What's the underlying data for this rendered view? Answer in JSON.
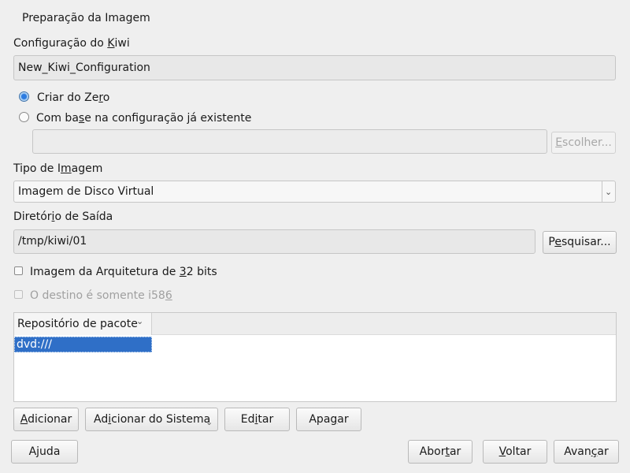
{
  "page": {
    "heading": "Preparação da Imagem"
  },
  "kiwi": {
    "label_pre": "Configuração do ",
    "label_ul": "K",
    "label_post": "iwi",
    "value": "New_Kiwi_Configuration"
  },
  "source": {
    "scratch_pre": "Criar do Ze",
    "scratch_ul": "r",
    "scratch_post": "o",
    "existing_pre": "Com ba",
    "existing_ul": "s",
    "existing_post": "e na configuração já existente",
    "existing_path": "",
    "choose_pre": "",
    "choose_ul": "E",
    "choose_post": "scolher..."
  },
  "image_type": {
    "label_pre": "Tipo de I",
    "label_ul": "m",
    "label_post": "agem",
    "selected": "Imagem de Disco Virtual"
  },
  "output": {
    "label_pre": "Diretór",
    "label_ul": "i",
    "label_post": "o de Saída",
    "value": "/tmp/kiwi/01",
    "browse_pre": "P",
    "browse_ul": "e",
    "browse_post": "squisar..."
  },
  "arch32": {
    "pre": "Imagem da Arquitetura de ",
    "ul": "3",
    "post": "2 bits"
  },
  "i586": {
    "pre": "O destino é somente i58",
    "ul": "6",
    "post": ""
  },
  "repos": {
    "column": "Repositório de pacote",
    "rows": [
      "dvd:///"
    ]
  },
  "repo_buttons": {
    "add_pre": "",
    "add_ul": "A",
    "add_post": "dicionar",
    "addsys_pre": "Ad",
    "addsys_ul": "i",
    "addsys_post": "cionar do Sistema",
    "edit_pre": "Ed",
    "edit_ul": "i",
    "edit_post": "tar",
    "delete_pre": "Apa",
    "delete_ul": "g",
    "delete_post": "ar"
  },
  "footer": {
    "help": "Ajuda",
    "abort_pre": "Abor",
    "abort_ul": "t",
    "abort_post": "ar",
    "back_pre": "",
    "back_ul": "V",
    "back_post": "oltar",
    "next_pre": "Avan",
    "next_ul": "ç",
    "next_post": "ar"
  }
}
